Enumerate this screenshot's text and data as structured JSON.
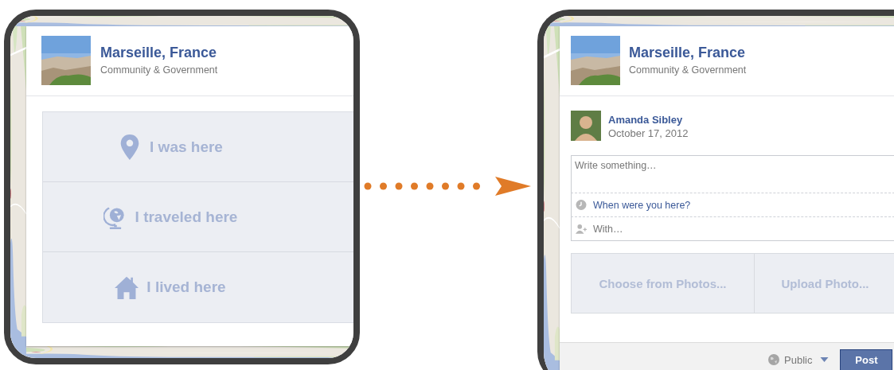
{
  "before": {
    "place": {
      "name": "Marseille, France",
      "category": "Community & Government"
    },
    "options": [
      {
        "label": "I was here"
      },
      {
        "label": "I traveled here"
      },
      {
        "label": "I lived here"
      }
    ]
  },
  "after": {
    "place": {
      "name": "Marseille, France",
      "category": "Community & Government"
    },
    "author": {
      "name": "Amanda Sibley",
      "date": "October 17, 2012"
    },
    "composer": {
      "placeholder": "Write something…"
    },
    "when_link": "When were you here?",
    "with_field": {
      "placeholder": "With…"
    },
    "photo_buttons": [
      "Choose from Photos...",
      "Upload Photo..."
    ],
    "privacy": "Public",
    "post_button": "Post"
  }
}
